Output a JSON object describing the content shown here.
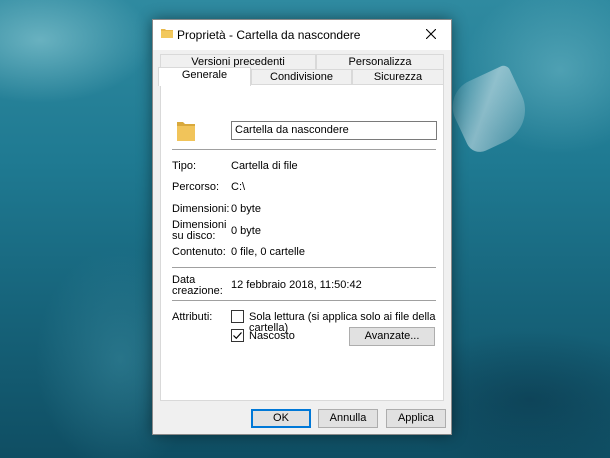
{
  "window": {
    "title": "Proprietà - Cartella da nascondere",
    "close_glyph": "✕"
  },
  "tabs": {
    "row1": [
      "Versioni precedenti",
      "Personalizza"
    ],
    "row2": [
      "Generale",
      "Condivisione",
      "Sicurezza"
    ],
    "active": "Generale"
  },
  "general": {
    "folder_name": "Cartella da nascondere",
    "type_label": "Tipo:",
    "type_value": "Cartella di file",
    "path_label": "Percorso:",
    "path_value": "C:\\",
    "size_label": "Dimensioni:",
    "size_value": "0 byte",
    "disk_size_label_1": "Dimensioni",
    "disk_size_label_2": "su disco:",
    "disk_size_value": "0 byte",
    "contents_label": "Contenuto:",
    "contents_value": "0 file, 0 cartelle",
    "created_label_1": "Data",
    "created_label_2": "creazione:",
    "created_value": "12 febbraio 2018, 11:50:42",
    "attributes_label": "Attributi:",
    "readonly_label": "Sola lettura (si applica solo ai file della cartella)",
    "readonly_checked": false,
    "hidden_label": "Nascosto",
    "hidden_checked": true,
    "advanced_button": "Avanzate..."
  },
  "footer": {
    "ok": "OK",
    "cancel": "Annulla",
    "apply": "Applica"
  },
  "colors": {
    "folder": "#e8b84a",
    "default_button_border": "#0078d7"
  },
  "icons": [
    "folder-icon",
    "close-icon",
    "check-icon"
  ]
}
